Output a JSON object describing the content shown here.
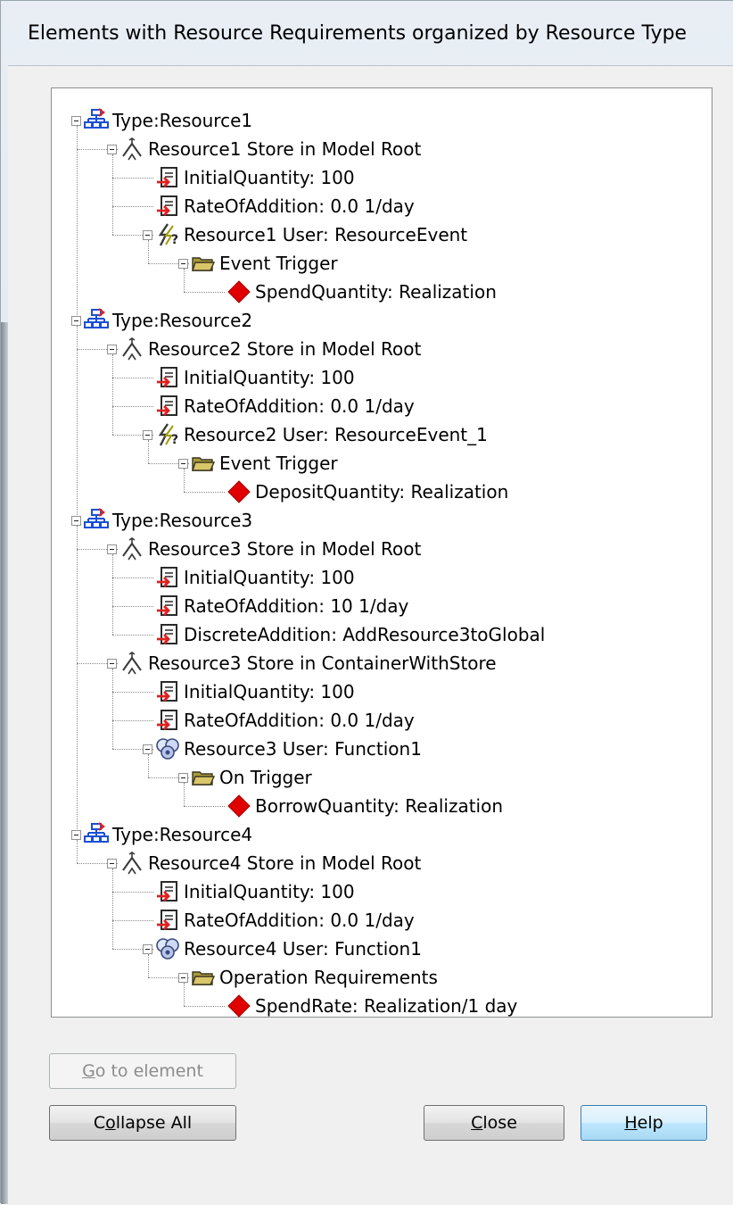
{
  "window": {
    "title": "Elements with Resource Requirements organized by Resource Type"
  },
  "tree": {
    "nodes": [
      {
        "label": "Type:Resource1",
        "icon": "resource-type-icon",
        "level": 0,
        "expanded": true
      },
      {
        "label": "Resource1 Store in Model Root",
        "icon": "store-icon",
        "level": 1,
        "expanded": true
      },
      {
        "label": "InitialQuantity: 100",
        "icon": "parameter-icon",
        "level": 2
      },
      {
        "label": "RateOfAddition: 0.0 1/day",
        "icon": "parameter-icon",
        "level": 2
      },
      {
        "label": "Resource1 User: ResourceEvent",
        "icon": "event-icon",
        "level": 2,
        "expanded": true
      },
      {
        "label": "Event Trigger",
        "icon": "folder-icon",
        "level": 3,
        "expanded": true
      },
      {
        "label": "SpendQuantity: Realization",
        "icon": "requirement-diamond-icon",
        "level": 4
      },
      {
        "label": "Type:Resource2",
        "icon": "resource-type-icon",
        "level": 0,
        "expanded": true
      },
      {
        "label": "Resource2 Store in Model Root",
        "icon": "store-icon",
        "level": 1,
        "expanded": true
      },
      {
        "label": "InitialQuantity: 100",
        "icon": "parameter-icon",
        "level": 2
      },
      {
        "label": "RateOfAddition: 0.0 1/day",
        "icon": "parameter-icon",
        "level": 2
      },
      {
        "label": "Resource2 User: ResourceEvent_1",
        "icon": "event-icon",
        "level": 2,
        "expanded": true
      },
      {
        "label": "Event Trigger",
        "icon": "folder-icon",
        "level": 3,
        "expanded": true
      },
      {
        "label": "DepositQuantity: Realization",
        "icon": "requirement-diamond-icon",
        "level": 4
      },
      {
        "label": "Type:Resource3",
        "icon": "resource-type-icon",
        "level": 0,
        "expanded": true
      },
      {
        "label": "Resource3 Store in Model Root",
        "icon": "store-icon",
        "level": 1,
        "expanded": true
      },
      {
        "label": "InitialQuantity: 100",
        "icon": "parameter-icon",
        "level": 2
      },
      {
        "label": "RateOfAddition: 10 1/day",
        "icon": "parameter-icon",
        "level": 2
      },
      {
        "label": "DiscreteAddition: AddResource3toGlobal",
        "icon": "parameter-icon",
        "level": 2
      },
      {
        "label": "Resource3 Store in ContainerWithStore",
        "icon": "store-icon",
        "level": 1,
        "expanded": true
      },
      {
        "label": "InitialQuantity: 100",
        "icon": "parameter-icon",
        "level": 2
      },
      {
        "label": "RateOfAddition: 0.0 1/day",
        "icon": "parameter-icon",
        "level": 2
      },
      {
        "label": "Resource3 User: Function1",
        "icon": "function-icon",
        "level": 2,
        "expanded": true
      },
      {
        "label": "On Trigger",
        "icon": "folder-icon",
        "level": 3,
        "expanded": true
      },
      {
        "label": "BorrowQuantity: Realization",
        "icon": "requirement-diamond-icon",
        "level": 4
      },
      {
        "label": "Type:Resource4",
        "icon": "resource-type-icon",
        "level": 0,
        "expanded": true
      },
      {
        "label": "Resource4 Store in Model Root",
        "icon": "store-icon",
        "level": 1,
        "expanded": true
      },
      {
        "label": "InitialQuantity: 100",
        "icon": "parameter-icon",
        "level": 2
      },
      {
        "label": "RateOfAddition: 0.0 1/day",
        "icon": "parameter-icon",
        "level": 2
      },
      {
        "label": "Resource4 User: Function1",
        "icon": "function-icon",
        "level": 2,
        "expanded": true
      },
      {
        "label": "Operation Requirements",
        "icon": "folder-icon",
        "level": 3,
        "expanded": true
      },
      {
        "label": "SpendRate: Realization/1 day",
        "icon": "requirement-diamond-icon",
        "level": 4
      }
    ]
  },
  "buttons": {
    "go_to_element": {
      "label": "Go to element",
      "mnemonic": "G",
      "enabled": false
    },
    "collapse_all": {
      "label": "Collapse All",
      "mnemonic": "o"
    },
    "close": {
      "label": "Close",
      "mnemonic": "C"
    },
    "help": {
      "label": "Help",
      "mnemonic": "H"
    }
  },
  "colors": {
    "requirement": "#e00000",
    "resource_type": "#1a4fd6",
    "arrow": "#e02020",
    "folder": "#d9c66a"
  }
}
